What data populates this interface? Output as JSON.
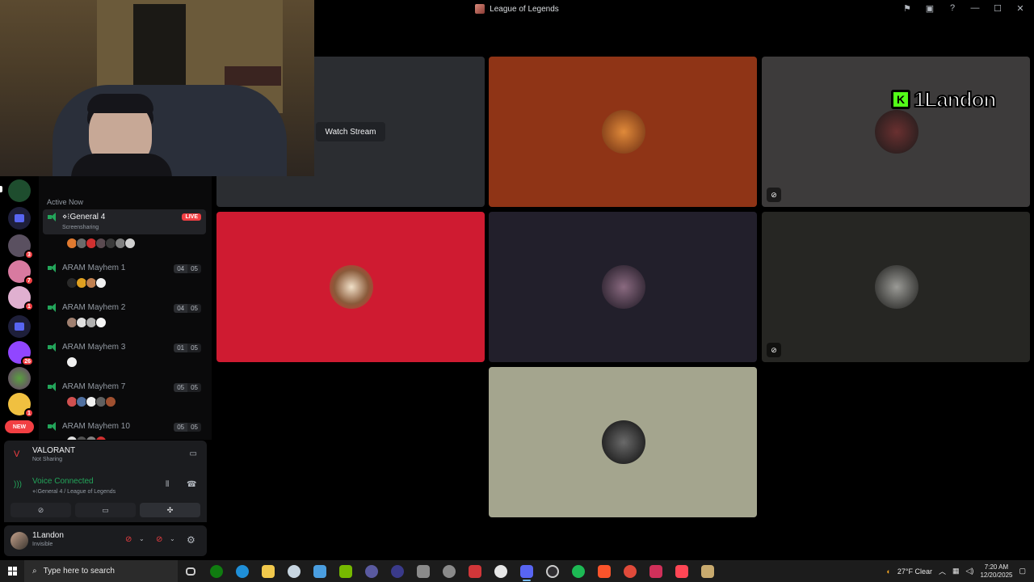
{
  "window": {
    "title": "League of Legends",
    "actions": [
      "inbox-icon",
      "window-icon",
      "help-icon",
      "minimize-icon",
      "maximize-icon",
      "close-icon"
    ]
  },
  "rail": {
    "servers": [
      {
        "badge": ""
      },
      {
        "badge": ""
      },
      {
        "badge": "3"
      },
      {
        "badge": "7"
      },
      {
        "badge": "1"
      },
      {
        "badge": ""
      },
      {
        "badge": "26"
      },
      {
        "badge": ""
      },
      {
        "badge": "1"
      }
    ],
    "new_label": "NEW"
  },
  "sidebar": {
    "section_label": "Active Now",
    "channels": [
      {
        "name": "⋄⁝General 4",
        "sub": "Screensharing",
        "live": "LIVE"
      },
      {
        "name": "ARAM Mayhem 1",
        "count": "04",
        "limit": "05"
      },
      {
        "name": "ARAM Mayhem 2",
        "count": "04",
        "limit": "05"
      },
      {
        "name": "ARAM Mayhem 3",
        "count": "01",
        "limit": "05"
      },
      {
        "name": "ARAM Mayhem 7",
        "count": "05",
        "limit": "05"
      },
      {
        "name": "ARAM Mayhem 10",
        "count": "05",
        "limit": "05"
      }
    ]
  },
  "activity": {
    "game": "VALORANT",
    "status": "Not Sharing"
  },
  "voice": {
    "status": "Voice Connected",
    "path": "⋄⁝General 4 / League of Legends"
  },
  "user": {
    "name": "1Landon",
    "status": "Invisible"
  },
  "stage": {
    "watch_label": "Watch Stream",
    "overlay_name": "1Landon",
    "overlay_badge": "K",
    "tiles": [
      {
        "bg": "#2b2d31"
      },
      {
        "bg": "#8f3416"
      },
      {
        "bg": "#3d3b3b"
      },
      {
        "bg": "#cf1b31"
      },
      {
        "bg": "#221f2b"
      },
      {
        "bg": "#262623"
      },
      {
        "bg": "#a4a58e"
      }
    ]
  },
  "taskbar": {
    "search_placeholder": "Type here to search",
    "weather": "27°F  Clear",
    "time": "7:20 AM",
    "date": "12/20/2025"
  },
  "colors": {
    "accent": "#5865f2",
    "green": "#23a55a",
    "red": "#f23f43"
  }
}
